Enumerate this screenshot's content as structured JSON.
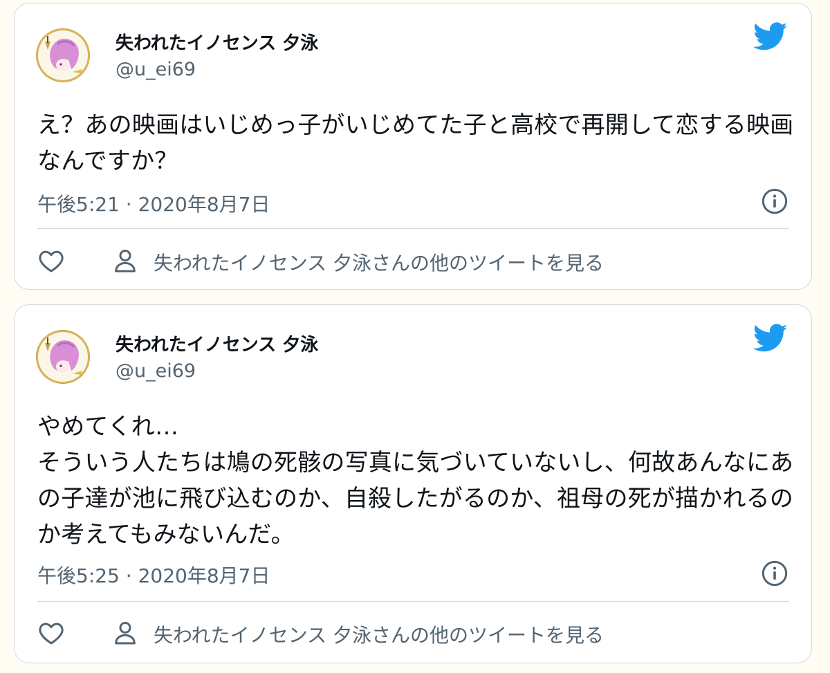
{
  "colors": {
    "page_background": "#fffdf3",
    "card_border": "#cfd9de",
    "text_primary": "#0f1419",
    "text_secondary": "#536471",
    "twitter_blue": "#1d9bf0"
  },
  "tweets": [
    {
      "author": {
        "display_name": "失われたイノセンス 夕泳",
        "handle": "@u_ei69"
      },
      "text": "え？あの映画はいじめっ子がいじめてた子と高校で再開して恋する映画なんですか？",
      "timestamp": "午後5:21 · 2020年8月7日",
      "icons": {
        "brand": "twitter-bird-icon",
        "info": "info-icon",
        "like": "heart-icon",
        "profile": "person-icon"
      },
      "more_tweets_label": "失われたイノセンス 夕泳さんの他のツイートを見る"
    },
    {
      "author": {
        "display_name": "失われたイノセンス 夕泳",
        "handle": "@u_ei69"
      },
      "text": "やめてくれ…\nそういう人たちは鳩の死骸の写真に気づいていないし、何故あんなにあの子達が池に飛び込むのか、自殺したがるのか、祖母の死が描かれるのか考えてもみないんだ。",
      "timestamp": "午後5:25 · 2020年8月7日",
      "icons": {
        "brand": "twitter-bird-icon",
        "info": "info-icon",
        "like": "heart-icon",
        "profile": "person-icon"
      },
      "more_tweets_label": "失われたイノセンス 夕泳さんの他のツイートを見る"
    }
  ]
}
